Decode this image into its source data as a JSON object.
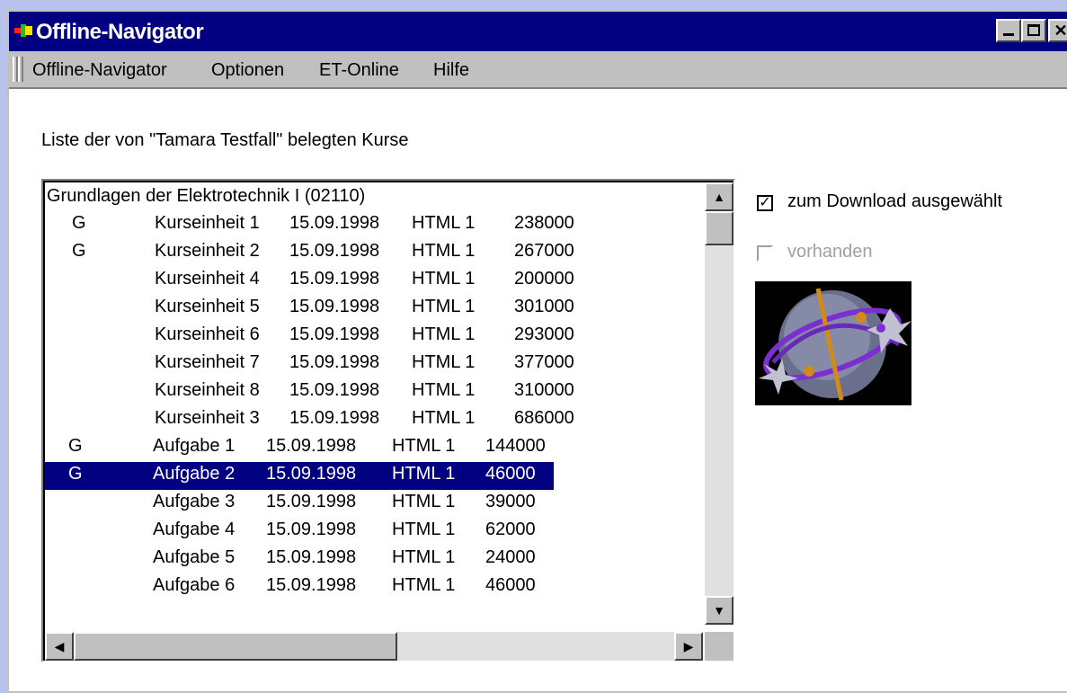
{
  "window": {
    "title": "Offline-Navigator"
  },
  "menu": [
    "Offline-Navigator",
    "Optionen",
    "ET-Online",
    "Hilfe"
  ],
  "caption": "Liste der von \"Tamara Testfall\" belegten Kurse",
  "list": {
    "header": "Grundlagen der Elektrotechnik I (02110)",
    "rows": [
      {
        "flag": "G",
        "name": "Kurseinheit 1",
        "date": "15.09.1998",
        "format": "HTML 1",
        "size": "238000"
      },
      {
        "flag": "G",
        "name": "Kurseinheit 2",
        "date": "15.09.1998",
        "format": "HTML 1",
        "size": "267000"
      },
      {
        "flag": "",
        "name": "Kurseinheit 4",
        "date": "15.09.1998",
        "format": "HTML 1",
        "size": "200000"
      },
      {
        "flag": "",
        "name": "Kurseinheit 5",
        "date": "15.09.1998",
        "format": "HTML 1",
        "size": "301000"
      },
      {
        "flag": "",
        "name": "Kurseinheit 6",
        "date": "15.09.1998",
        "format": "HTML 1",
        "size": "293000"
      },
      {
        "flag": "",
        "name": "Kurseinheit 7",
        "date": "15.09.1998",
        "format": "HTML 1",
        "size": "377000"
      },
      {
        "flag": "",
        "name": "Kurseinheit 8",
        "date": "15.09.1998",
        "format": "HTML 1",
        "size": "310000"
      },
      {
        "flag": "",
        "name": "Kurseinheit 3",
        "date": "15.09.1998",
        "format": "HTML 1",
        "size": "686000"
      },
      {
        "flag": "G",
        "name": "Aufgabe 1",
        "date": "15.09.1998",
        "format": "HTML 1",
        "size": "144000"
      },
      {
        "flag": "G",
        "name": "Aufgabe 2",
        "date": "15.09.1998",
        "format": "HTML 1",
        "size": "46000",
        "selected": true
      },
      {
        "flag": "",
        "name": "Aufgabe 3",
        "date": "15.09.1998",
        "format": "HTML 1",
        "size": "39000"
      },
      {
        "flag": "",
        "name": "Aufgabe 4",
        "date": "15.09.1998",
        "format": "HTML 1",
        "size": "62000"
      },
      {
        "flag": "",
        "name": "Aufgabe 5",
        "date": "15.09.1998",
        "format": "HTML 1",
        "size": "24000"
      },
      {
        "flag": "",
        "name": "Aufgabe 6",
        "date": "15.09.1998",
        "format": "HTML 1",
        "size": "46000"
      }
    ]
  },
  "options": {
    "download": {
      "label": "zum Download ausgewählt",
      "checked": true,
      "mark": "✓"
    },
    "present": {
      "label": "vorhanden",
      "checked": false,
      "disabled": true
    }
  },
  "colors": {
    "selection": "#000080",
    "titlebar": "#000080",
    "disabled_text": "#a0a0a0"
  }
}
